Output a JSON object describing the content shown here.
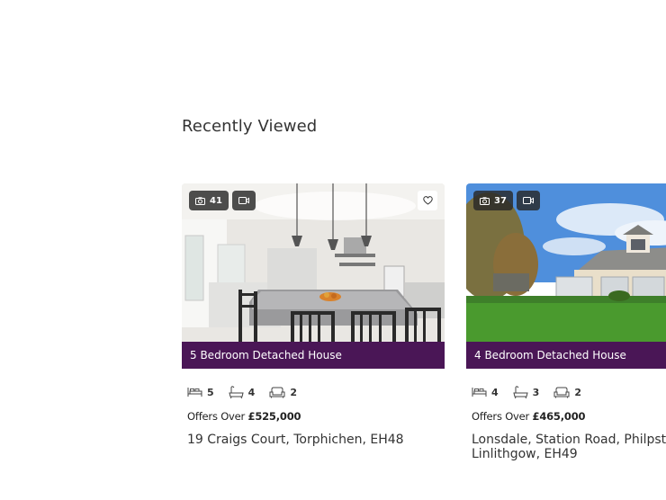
{
  "section": {
    "title": "Recently Viewed"
  },
  "listings": [
    {
      "photo_count": "41",
      "property_type": "5 Bedroom Detached House",
      "bedrooms": "5",
      "bathrooms": "4",
      "receptions": "2",
      "price_prefix": "Offers Over",
      "price": "£525,000",
      "address_line1": "19 Craigs Court, Torphichen, EH48",
      "address_line2": ""
    },
    {
      "photo_count": "37",
      "property_type": "4 Bedroom Detached House",
      "bedrooms": "4",
      "bathrooms": "3",
      "receptions": "2",
      "price_prefix": "Offers Over",
      "price": "£465,000",
      "address_line1": "Lonsdale, Station Road, Philpstoun",
      "address_line2": "Linlithgow, EH49"
    }
  ],
  "icons": {
    "photo": "camera-icon",
    "video": "video-icon",
    "favourite": "heart-icon",
    "bedrooms": "bed-icon",
    "bathrooms": "bath-icon",
    "receptions": "sofa-icon"
  },
  "colors": {
    "type_bar": "#4a1656",
    "badge_bg": "#282828",
    "text": "#333333"
  }
}
